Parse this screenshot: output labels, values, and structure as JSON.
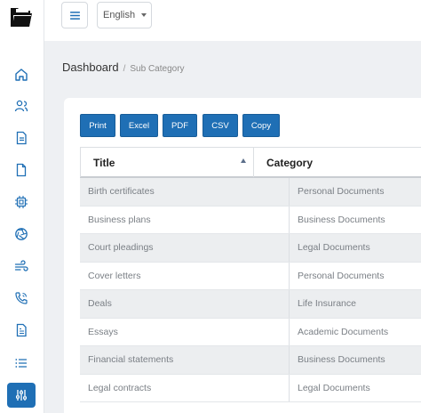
{
  "topbar": {
    "language": "English"
  },
  "breadcrumb": {
    "main": "Dashboard",
    "separator": "/",
    "current": "Sub Category"
  },
  "export_buttons": {
    "print": "Print",
    "excel": "Excel",
    "pdf": "PDF",
    "csv": "CSV",
    "copy": "Copy"
  },
  "table": {
    "headers": {
      "title": "Title",
      "category": "Category"
    },
    "rows": [
      {
        "title": "Birth certificates",
        "category": "Personal Documents"
      },
      {
        "title": "Business plans",
        "category": "Business Documents"
      },
      {
        "title": "Court pleadings",
        "category": "Legal Documents"
      },
      {
        "title": "Cover letters",
        "category": "Personal Documents"
      },
      {
        "title": "Deals",
        "category": "Life Insurance"
      },
      {
        "title": "Essays",
        "category": "Academic Documents"
      },
      {
        "title": "Financial statements",
        "category": "Business Documents"
      },
      {
        "title": "Legal contracts",
        "category": "Legal Documents"
      }
    ]
  },
  "sidebar": {
    "icons": [
      "home-icon",
      "users-icon",
      "document-icon",
      "file-icon",
      "cpu-icon",
      "aperture-icon",
      "wind-icon",
      "phone-call-icon",
      "file-text-icon",
      "list-icon",
      "sliders-icon"
    ]
  },
  "colors": {
    "primary": "#1f6fb5",
    "sidebar_icon": "#1f6fb5",
    "background": "#eef0f3"
  }
}
